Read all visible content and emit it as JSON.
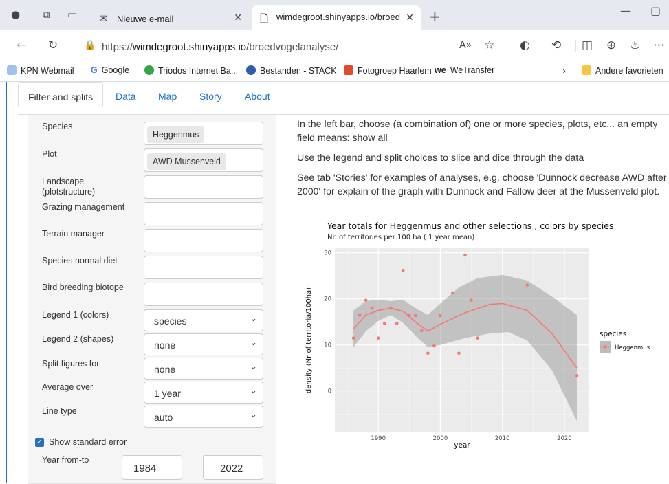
{
  "browser": {
    "tabs": [
      {
        "title": "Nieuwe e-mail"
      },
      {
        "title": "wimdegroot.shinyapps.io/broedv"
      }
    ],
    "url_prefix": "https://",
    "url_host": "wimdegroot.shinyapps.io",
    "url_path": "/broedvogelanalyse/",
    "favorites": [
      "KPN Webmail",
      "Google",
      "Triodos Internet Ba...",
      "Bestanden - STACK",
      "Fotogroep Haarlem",
      "WeTransfer"
    ],
    "other_favorites": "Andere favorieten",
    "accent": "#1a6fc4"
  },
  "app": {
    "tabs": [
      "Filter and splits",
      "Data",
      "Map",
      "Story",
      "About"
    ],
    "filters": {
      "species_label": "Species",
      "species_value": "Heggenmus",
      "plot_label": "Plot",
      "plot_value": "AWD Mussenveld",
      "landscape_label_1": "Landscape",
      "landscape_label_2": "(plotstructure)",
      "grazing_label": "Grazing management",
      "terrain_label": "Terrain manager",
      "diet_label": "Species normal diet",
      "biotope_label": "Bird breeding biotope",
      "legend1_label": "Legend 1 (colors)",
      "legend1_value": "species",
      "legend2_label": "Legend 2 (shapes)",
      "legend2_value": "none",
      "split_label": "Split figures for",
      "split_value": "none",
      "average_label": "Average over",
      "average_value": "1 year",
      "linetype_label": "Line type",
      "linetype_value": "auto",
      "stderr_label": "Show standard error",
      "stderr_checked": true,
      "year_label": "Year from-to",
      "year_from": "1984",
      "year_to": "2022"
    },
    "text": {
      "p1": "In the left bar, choose (a combination of) one or more species, plots, etc... an empty field means: show all",
      "p2": "Use the legend and split choices to slice and dice through the data",
      "p3": "See tab 'Stories' for examples of analyses, e.g. choose 'Dunnock decrease AWD after 2000' for explain of the graph with Dunnock and Fallow deer at the Mussenveld plot."
    }
  },
  "chart_data": {
    "type": "scatter",
    "title": "Year totals for Heggenmus and other selections , colors by species",
    "subtitle": "Nr. of territories per 100 ha ( 1 year mean)",
    "xlabel": "year",
    "ylabel": "density (Nr of territoria/100ha)",
    "xlim": [
      1983,
      2024
    ],
    "ylim": [
      -9,
      31
    ],
    "xticks": [
      1990,
      2000,
      2010,
      2020
    ],
    "yticks": [
      0,
      10,
      20,
      30
    ],
    "legend_title": "species",
    "legend_placement": "right",
    "grid": true,
    "series": [
      {
        "name": "Heggenmus",
        "color": "#f8766d",
        "points": [
          [
            1986,
            11.5
          ],
          [
            1987,
            16.5
          ],
          [
            1988,
            19.7
          ],
          [
            1989,
            18
          ],
          [
            1990,
            11.5
          ],
          [
            1991,
            14.7
          ],
          [
            1992,
            18
          ],
          [
            1993,
            14.7
          ],
          [
            1994,
            26.2
          ],
          [
            1995,
            16.4
          ],
          [
            1996,
            16.4
          ],
          [
            1997,
            13.1
          ],
          [
            1998,
            8.2
          ],
          [
            1999,
            9.8
          ],
          [
            2000,
            16.4
          ],
          [
            2002,
            21.3
          ],
          [
            2003,
            8.2
          ],
          [
            2004,
            29.5
          ],
          [
            2005,
            19.7
          ],
          [
            2006,
            11.5
          ],
          [
            2014,
            23
          ],
          [
            2022,
            3.3
          ]
        ],
        "smooth": [
          [
            1986,
            13.5
          ],
          [
            1988,
            16.5
          ],
          [
            1990,
            17.5
          ],
          [
            1992,
            18
          ],
          [
            1994,
            17.3
          ],
          [
            1996,
            15
          ],
          [
            1998,
            13
          ],
          [
            2000,
            14.5
          ],
          [
            2004,
            17
          ],
          [
            2008,
            18.8
          ],
          [
            2010,
            19
          ],
          [
            2014,
            17.5
          ],
          [
            2018,
            12.5
          ],
          [
            2022,
            5
          ]
        ],
        "band_upper": [
          [
            1986,
            17.5
          ],
          [
            1988,
            19.5
          ],
          [
            1990,
            19.8
          ],
          [
            1992,
            19.5
          ],
          [
            1994,
            19.8
          ],
          [
            1996,
            18
          ],
          [
            1998,
            16.5
          ],
          [
            2000,
            19
          ],
          [
            2003,
            22.5
          ],
          [
            2006,
            24.5
          ],
          [
            2010,
            25.2
          ],
          [
            2014,
            24
          ],
          [
            2018,
            20.5
          ],
          [
            2022,
            16.5
          ]
        ],
        "band_lower": [
          [
            1986,
            9.5
          ],
          [
            1988,
            13
          ],
          [
            1990,
            15.2
          ],
          [
            1992,
            16.5
          ],
          [
            1994,
            14.8
          ],
          [
            1996,
            12
          ],
          [
            1998,
            9.5
          ],
          [
            2000,
            10
          ],
          [
            2004,
            11.5
          ],
          [
            2008,
            12.5
          ],
          [
            2011,
            12.8
          ],
          [
            2014,
            11
          ],
          [
            2018,
            4.5
          ],
          [
            2022,
            -6.5
          ]
        ]
      }
    ]
  }
}
